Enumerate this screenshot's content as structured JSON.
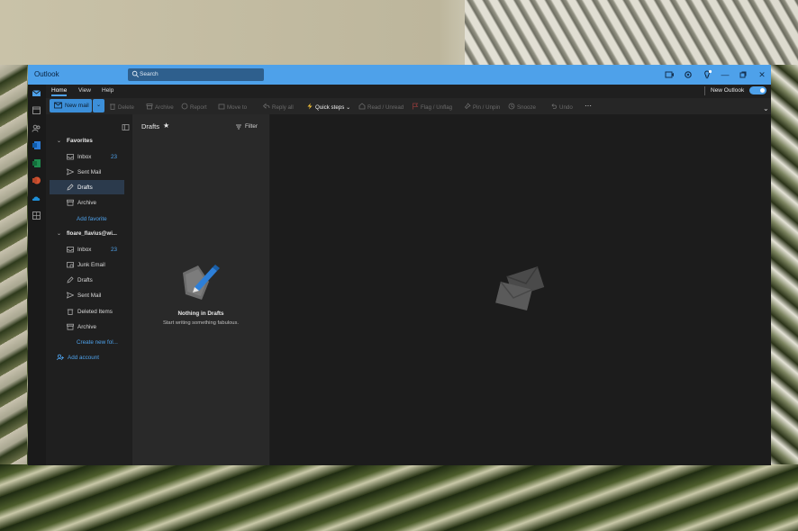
{
  "window": {
    "app_title": "Outlook",
    "search_placeholder": "Search"
  },
  "menu": {
    "tabs": [
      {
        "label": "Home",
        "active": true
      },
      {
        "label": "View",
        "active": false
      },
      {
        "label": "Help",
        "active": false
      }
    ],
    "new_outlook_label": "New Outlook",
    "new_outlook_enabled": true
  },
  "toolbar": {
    "new_mail": "New mail",
    "items": [
      {
        "label": "Delete",
        "icon": "trash-icon",
        "enabled": false
      },
      {
        "label": "Archive",
        "icon": "archive-icon",
        "enabled": false
      },
      {
        "label": "Report",
        "icon": "report-icon",
        "enabled": false
      },
      {
        "label": "Move to",
        "icon": "move-icon",
        "enabled": false
      },
      {
        "label": "Reply all",
        "icon": "reply-all-icon",
        "enabled": false
      },
      {
        "label": "Quick steps",
        "icon": "lightning-icon",
        "enabled": true
      },
      {
        "label": "Read / Unread",
        "icon": "envelope-open-icon",
        "enabled": false
      },
      {
        "label": "Flag / Unflag",
        "icon": "flag-icon",
        "enabled": false
      },
      {
        "label": "Pin / Unpin",
        "icon": "pin-icon",
        "enabled": false
      },
      {
        "label": "Snooze",
        "icon": "clock-icon",
        "enabled": false
      },
      {
        "label": "Undo",
        "icon": "undo-icon",
        "enabled": false
      },
      {
        "label": "···",
        "icon": "more-icon",
        "enabled": true
      }
    ]
  },
  "folders": {
    "favorites_label": "Favorites",
    "favorites": [
      {
        "label": "Inbox",
        "icon": "inbox-icon",
        "count": "23"
      },
      {
        "label": "Sent Mail",
        "icon": "send-icon",
        "count": ""
      },
      {
        "label": "Drafts",
        "icon": "pencil-icon",
        "count": "",
        "selected": true
      },
      {
        "label": "Archive",
        "icon": "archive-icon",
        "count": ""
      }
    ],
    "add_favorite": "Add favorite",
    "account_label": "floare_flavius@wi...",
    "account": [
      {
        "label": "Inbox",
        "icon": "inbox-icon",
        "count": "23"
      },
      {
        "label": "Junk Email",
        "icon": "junk-icon",
        "count": ""
      },
      {
        "label": "Drafts",
        "icon": "pencil-icon",
        "count": ""
      },
      {
        "label": "Sent Mail",
        "icon": "send-icon",
        "count": ""
      },
      {
        "label": "Deleted Items",
        "icon": "trash-icon",
        "count": ""
      },
      {
        "label": "Archive",
        "icon": "archive-icon",
        "count": ""
      }
    ],
    "create_new_folder": "Create new fol...",
    "add_account": "Add account"
  },
  "message_list": {
    "title": "Drafts",
    "filter_label": "Filter",
    "empty_title": "Nothing in Drafts",
    "empty_subtitle": "Start writing something fabulous."
  },
  "colors": {
    "accent": "#4ea1ea",
    "titlebar": "#4ea1ea",
    "pane_dark": "#1f1f1f",
    "selected": "#2b3a4c"
  }
}
